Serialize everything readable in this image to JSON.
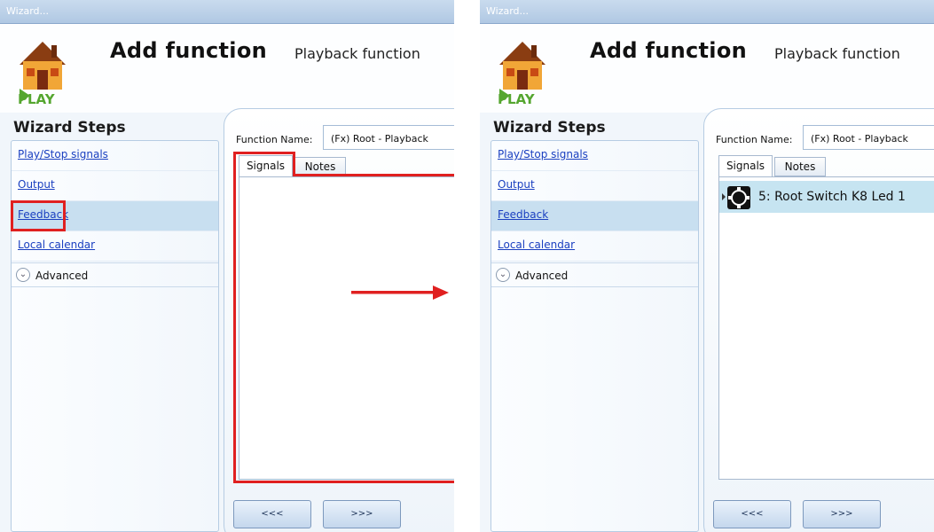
{
  "window": {
    "title": "Wizard..."
  },
  "header": {
    "title": "Add function",
    "subtitle": "Playback function",
    "logo_label": "PLAY"
  },
  "sidebar": {
    "title": "Wizard Steps",
    "items": [
      {
        "label": "Play/Stop signals"
      },
      {
        "label": "Output"
      },
      {
        "label": "Feedback",
        "selected": true
      },
      {
        "label": "Local calendar"
      }
    ],
    "advanced": {
      "label": "Advanced"
    }
  },
  "form": {
    "function_name_label": "Function Name:",
    "function_name_value": "(Fx) Root - Playback"
  },
  "tabs": [
    {
      "label": "Signals",
      "active": true
    },
    {
      "label": "Notes"
    }
  ],
  "signals_after": [
    {
      "label": "5: Root Switch K8 Led 1",
      "icon": "switch-led-icon"
    }
  ],
  "nav": {
    "prev_label": "<<<",
    "next_label": ">>>"
  },
  "colors": {
    "highlight": "#e02020",
    "selected_row": "#c6e4f1",
    "link": "#1a3fc0"
  },
  "icons": {
    "logo": "house-play-icon",
    "advanced": "chevron-down-circle-icon",
    "annotation": "arrow-right-icon"
  }
}
